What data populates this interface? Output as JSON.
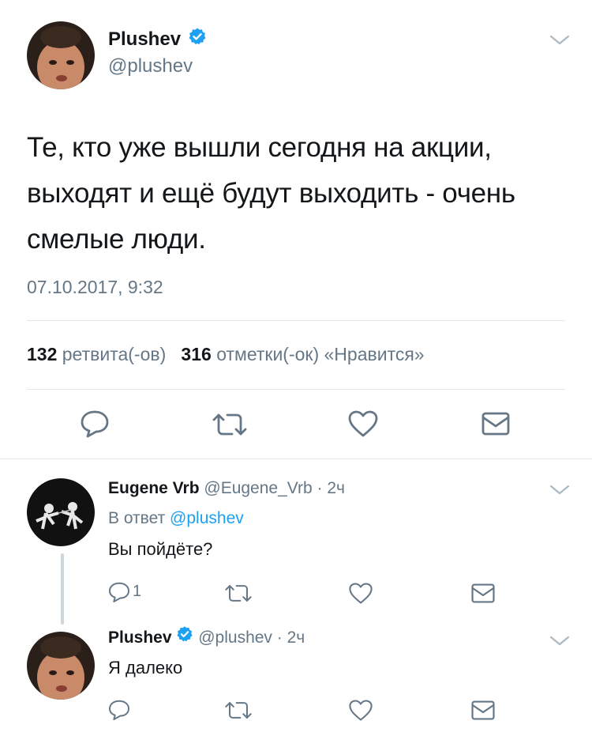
{
  "main_tweet": {
    "author_name": "Plushev",
    "author_handle": "@plushev",
    "text_line1": "Те, кто уже вышли сегодня на акции,",
    "text_line2": "выходят и ещё будут выходить - очень",
    "text_line3": "смелые люди.",
    "timestamp": "07.10.2017, 9:32",
    "retweets_count": "132",
    "retweets_label": "ретвита(-ов)",
    "likes_count": "316",
    "likes_label": "отметки(-ок) «Нравится»",
    "actions": [
      "reply-icon",
      "retweet-icon",
      "like-icon",
      "dm-icon"
    ]
  },
  "replies": [
    {
      "author_name": "Eugene Vrb",
      "author_handle": "@Eugene_Vrb",
      "time": "· 2ч",
      "reply_to_prefix": "В ответ",
      "reply_to_handle": "@plushev",
      "text": "Вы пойдёте?",
      "reply_count": "1"
    },
    {
      "author_name": "Plushev",
      "author_handle": "@plushev",
      "time": "· 2ч",
      "text": "Я далеко",
      "reply_count": ""
    }
  ],
  "colors": {
    "verified": "#1da1f2",
    "link": "#1da1f2",
    "muted": "#657786",
    "divider": "#e1e8ed"
  }
}
